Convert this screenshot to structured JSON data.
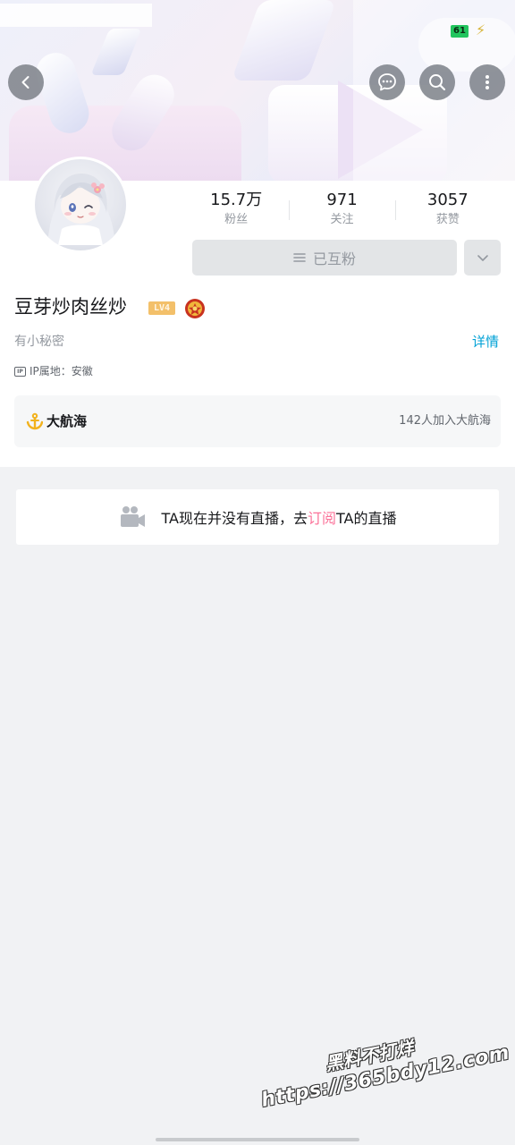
{
  "status_bar": {
    "battery_level": "61"
  },
  "header": {
    "back_icon": "chevron-left-icon",
    "message_icon": "chat-bubble-icon",
    "search_icon": "search-icon",
    "more_icon": "more-vertical-icon"
  },
  "profile": {
    "stats": [
      {
        "value": "15.7万",
        "label": "粉丝"
      },
      {
        "value": "971",
        "label": "关注"
      },
      {
        "value": "3057",
        "label": "获赞"
      }
    ],
    "follow_button_label": "已互粉",
    "username": "豆芽炒肉丝炒",
    "level_badge": "LV4",
    "bio": "有小秘密",
    "detail_link": "详情",
    "ip_icon_text": "IP",
    "ip_location": "IP属地：安徽",
    "guard": {
      "title": "大航海",
      "count_text": "142人加入大航海"
    }
  },
  "live": {
    "text_before": "TA现在并没有直播，去",
    "link": "订阅",
    "text_after": "TA的直播"
  },
  "watermark": {
    "line1": "黑料不打烊",
    "line2": "https://365bdy12.com"
  },
  "colors": {
    "accent_pink": "#fb7299",
    "link_blue": "#00a1d6",
    "battery_green": "#22c55e"
  }
}
